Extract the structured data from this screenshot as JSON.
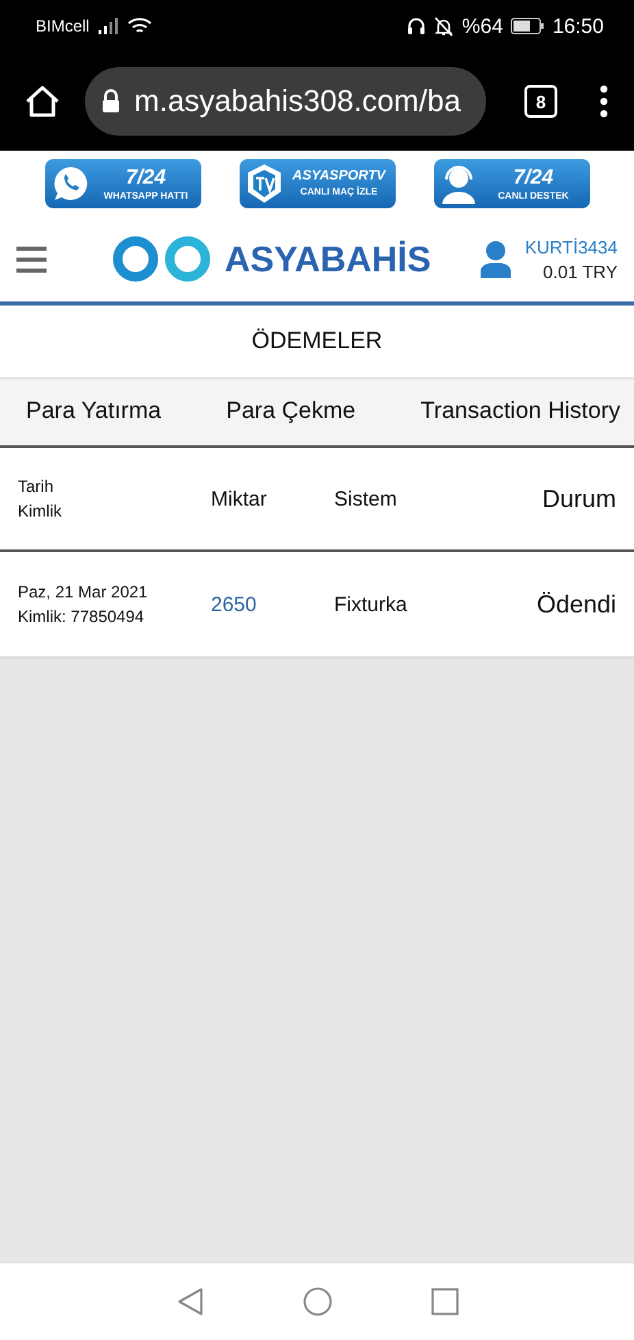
{
  "status_bar": {
    "carrier": "BIMcell",
    "battery": "%64",
    "time": "16:50"
  },
  "browser": {
    "url": "m.asyabahis308.com/ba",
    "tab_count": "8"
  },
  "banners": [
    {
      "kind": "whatsapp",
      "title": "7/24",
      "subtitle": "WHATSAPP HATTI"
    },
    {
      "kind": "tv",
      "title": "ASYASPORTV",
      "subtitle": "CANLI MAÇ İZLE"
    },
    {
      "kind": "support",
      "title": "7/24",
      "subtitle": "CANLI DESTEK"
    }
  ],
  "header": {
    "logo": "ASYABAHİS",
    "username": "KURTİ3434",
    "balance": "0.01 TRY"
  },
  "page_title": "ÖDEMELER",
  "tabs": [
    {
      "label": "Para Yatırma",
      "selected": false
    },
    {
      "label": "Para Çekme",
      "selected": false
    },
    {
      "label": "Transaction History",
      "selected": false
    }
  ],
  "table": {
    "columns": [
      {
        "lines": [
          "Tarih",
          "Kimlik"
        ]
      },
      {
        "lines": [
          "Miktar"
        ]
      },
      {
        "lines": [
          "Sistem"
        ]
      },
      {
        "lines": [
          "Durum"
        ]
      }
    ],
    "rows": [
      {
        "date": "Paz, 21 Mar 2021",
        "id": "Kimlik: 77850494",
        "amount": "2650",
        "system": "Fixturka",
        "status": "Ödendi"
      }
    ]
  }
}
